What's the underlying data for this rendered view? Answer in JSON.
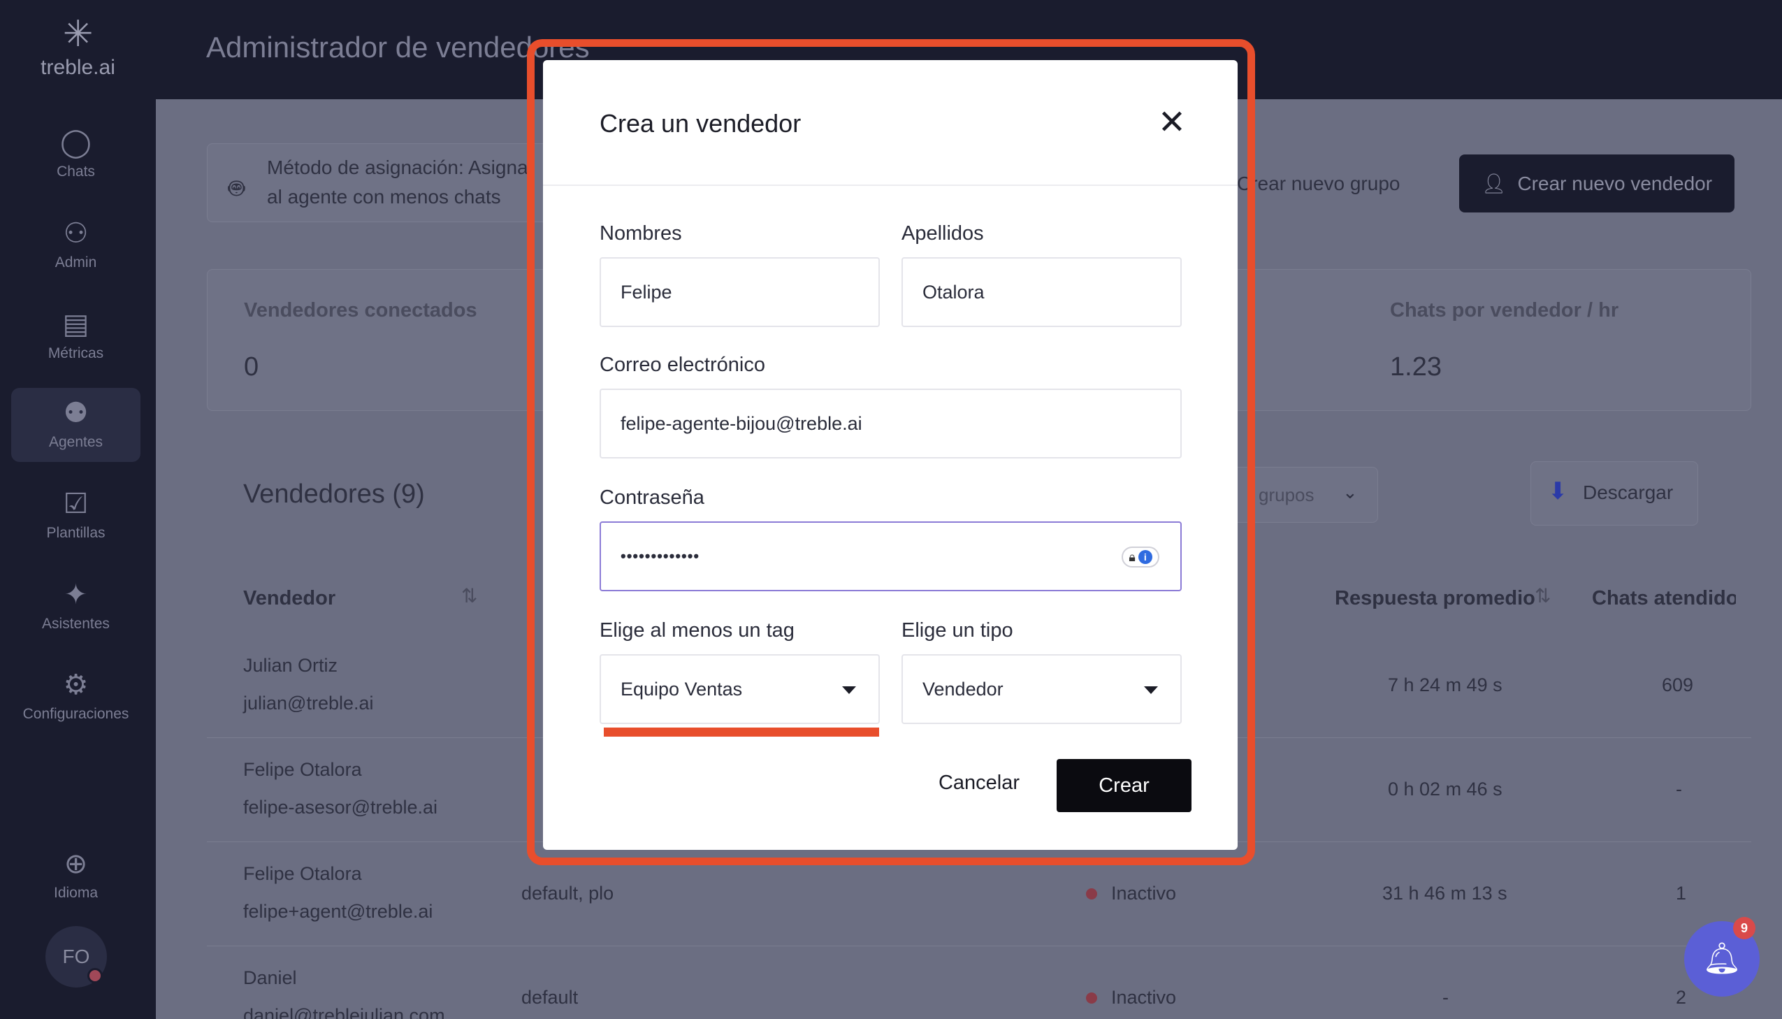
{
  "sidebar": {
    "logo_text": "treble.ai",
    "items": [
      {
        "icon": "chat-icon",
        "glyph": "◯",
        "label": "Chats"
      },
      {
        "icon": "admin-icon",
        "glyph": "⚇",
        "label": "Admin"
      },
      {
        "icon": "metrics-icon",
        "glyph": "▤",
        "label": "Métricas"
      },
      {
        "icon": "agents-icon",
        "glyph": "⚉",
        "label": "Agentes"
      },
      {
        "icon": "templates-icon",
        "glyph": "☑",
        "label": "Plantillas"
      },
      {
        "icon": "assistants-icon",
        "glyph": "✦",
        "label": "Asistentes"
      },
      {
        "icon": "settings-icon",
        "glyph": "⚙",
        "label": "Configuraciones"
      },
      {
        "icon": "globe-icon",
        "glyph": "⊕",
        "label": "Idioma"
      }
    ],
    "avatar_initials": "FO"
  },
  "header": {
    "title": "Administrador de vendedores"
  },
  "background": {
    "assignment_method": "Método de asignación: Asigna",
    "assignment_method_line2": "al agente con menos chats",
    "btn_new_group": "Crear nuevo grupo",
    "btn_new_seller": "Crear nuevo vendedor",
    "stat1_label": "Vendedores conectados",
    "stat1_value": "0",
    "stat2_label": "Chats por vendedor / hr",
    "stat2_value": "1.23",
    "list_title": "Vendedores (9)",
    "group_filter": "grupos",
    "download": "Descargar",
    "col_vendedor": "Vendedor",
    "col_respuesta": "Respuesta promedio",
    "col_chats": "Chats atendidos",
    "rows": [
      {
        "name": "Julian Ortiz",
        "email": "julian@treble.ai",
        "tags": "",
        "status": "",
        "response": "7 h 24 m 49 s",
        "chats": "609"
      },
      {
        "name": "Felipe Otalora",
        "email": "felipe-asesor@treble.ai",
        "tags": "",
        "status": "",
        "response": "0 h 02 m 46 s",
        "chats": "-"
      },
      {
        "name": "Felipe Otalora",
        "email": "felipe+agent@treble.ai",
        "tags": "default, plo",
        "status": "Inactivo",
        "response": "31 h 46 m 13 s",
        "chats": "1"
      },
      {
        "name": "Daniel",
        "email": "daniel@treblejulian.com",
        "tags": "default",
        "status": "Inactivo",
        "response": "-",
        "chats": "2"
      }
    ]
  },
  "modal": {
    "title": "Crea un vendedor",
    "first_name_label": "Nombres",
    "first_name_value": "Felipe",
    "last_name_label": "Apellidos",
    "last_name_value": "Otalora",
    "email_label": "Correo electrónico",
    "email_value": "felipe-agente-bijou@treble.ai",
    "password_label": "Contraseña",
    "password_value": "•••••••••••••",
    "tag_label": "Elige al menos un tag",
    "tag_value": "Equipo Ventas",
    "type_label": "Elige un tipo",
    "type_value": "Vendedor",
    "cancel": "Cancelar",
    "create": "Crear"
  },
  "notifications": {
    "count": "9"
  },
  "colors": {
    "highlight": "#e84e2c",
    "sidebar": "#1a1c2e",
    "notification": "#5b5fd6"
  }
}
